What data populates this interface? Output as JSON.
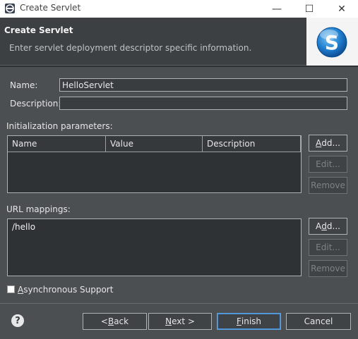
{
  "window": {
    "title": "Create Servlet",
    "minimize_glyph": "—",
    "maximize_glyph": "☐",
    "close_glyph": "✕"
  },
  "banner": {
    "title": "Create Servlet",
    "description": "Enter servlet deployment descriptor specific information.",
    "logo_letter": "S"
  },
  "form": {
    "name_label": "Name:",
    "name_value": "HelloServlet",
    "description_label": "Description:",
    "description_value": ""
  },
  "init_params": {
    "label": "Initialization parameters:",
    "columns": [
      "Name",
      "Value",
      "Description"
    ],
    "rows": [],
    "buttons": {
      "add": {
        "pre": "",
        "mnemonic": "A",
        "post": "dd..."
      },
      "edit": "Edit...",
      "remove": "Remove"
    }
  },
  "url_mappings": {
    "label": "URL mappings:",
    "items": [
      "/hello"
    ],
    "buttons": {
      "add": {
        "pre": "A",
        "mnemonic": "d",
        "post": "d..."
      },
      "edit": "Edit...",
      "remove": "Remove"
    }
  },
  "async": {
    "pre": "",
    "mnemonic": "A",
    "post": "synchronous Support",
    "checked": false
  },
  "footer": {
    "help_glyph": "?",
    "back": {
      "pre": "< ",
      "mnemonic": "B",
      "post": "ack"
    },
    "next": {
      "pre": "",
      "mnemonic": "N",
      "post": "ext >"
    },
    "finish": {
      "pre": "",
      "mnemonic": "F",
      "post": "inish"
    },
    "cancel": "Cancel"
  },
  "colors": {
    "background": "#4b4f52",
    "banner": "#3d4043",
    "default_button_border": "#5aa0e0"
  }
}
